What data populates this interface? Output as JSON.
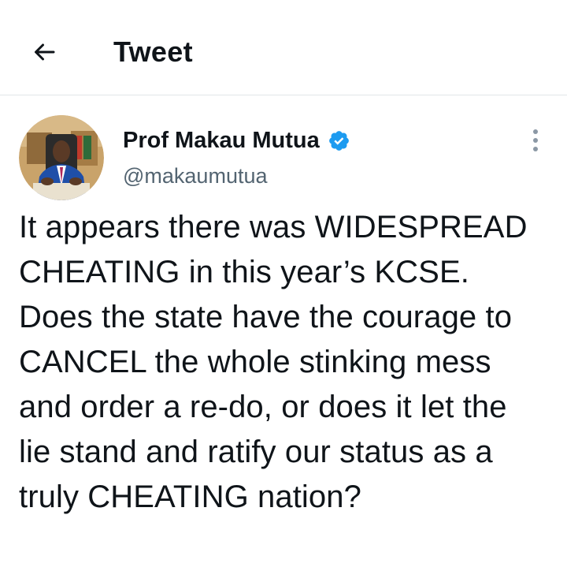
{
  "header": {
    "title": "Tweet",
    "back_icon": "arrow-left-icon"
  },
  "author": {
    "display_name": "Prof Makau Mutua",
    "handle": "@makaumutua",
    "verified": true,
    "verified_color": "#1d9bf0",
    "avatar_icon": "profile-photo"
  },
  "tweet": {
    "text": "It appears there was WIDESPREAD CHEATING in this year’s KCSE.  Does the state have the courage to CANCEL the whole stinking mess and order a re-do, or does it let the lie stand and ratify our status as a truly CHEATING nation?"
  },
  "colors": {
    "text_primary": "#0f1419",
    "text_secondary": "#536471",
    "divider": "#e1e5e8",
    "background": "#ffffff"
  }
}
